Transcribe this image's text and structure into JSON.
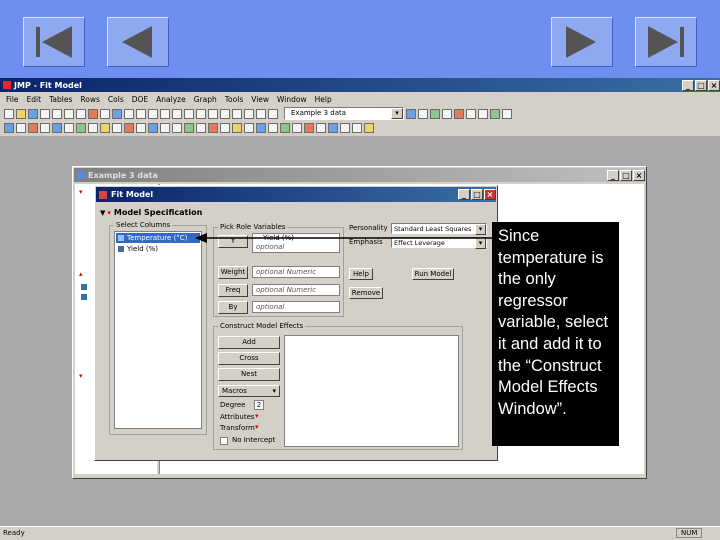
{
  "nav": {
    "first_icon": "first-slide-icon",
    "prev_icon": "prev-slide-icon",
    "next_icon": "next-slide-icon",
    "last_icon": "last-slide-icon"
  },
  "app": {
    "title": "JMP - Fit Model",
    "menu": [
      "File",
      "Edit",
      "Tables",
      "Rows",
      "Cols",
      "DOE",
      "Analyze",
      "Graph",
      "Tools",
      "View",
      "Window",
      "Help"
    ],
    "table_select_value": "Example 3 data",
    "status_left": "Ready",
    "status_right": "NUM"
  },
  "data_window": {
    "title": "Example 3 data"
  },
  "fit_model": {
    "title": "Fit Model",
    "section_title": "Model Specification",
    "select_columns_label": "Select Columns",
    "columns": [
      "Temperature (°C)",
      "Yield (%)"
    ],
    "pick_role_label": "Pick Role Variables",
    "y_button": "Y",
    "y_value": "Yield (%)",
    "y_optional": "optional",
    "weight_button": "Weight",
    "weight_value": "optional Numeric",
    "freq_button": "Freq",
    "freq_value": "optional Numeric",
    "by_button": "By",
    "by_value": "optional",
    "personality_label": "Personality",
    "personality_value": "Standard Least Squares",
    "emphasis_label": "Emphasis",
    "emphasis_value": "Effect Leverage",
    "help_button": "Help",
    "run_button": "Run Model",
    "remove_button": "Remove",
    "construct_label": "Construct Model Effects",
    "add_button": "Add",
    "cross_button": "Cross",
    "nest_button": "Nest",
    "macros_value": "Macros",
    "degree_label": "Degree",
    "degree_value": "2",
    "attributes_label": "Attributes",
    "transform_label": "Transform",
    "no_intercept_label": "No Intercept"
  },
  "callout": {
    "text": "Since temperature is the only regressor variable, select it and add it to the “Construct Model Effects Window”."
  }
}
